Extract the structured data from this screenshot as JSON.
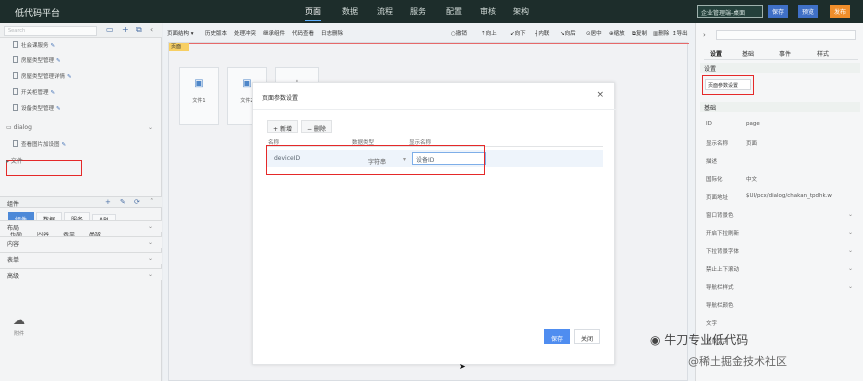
{
  "app": {
    "name": "低代码平台",
    "nav": [
      "页面",
      "数据",
      "流程",
      "服务",
      "配置",
      "审核",
      "架构"
    ],
    "env": "企业管理端-桌面",
    "buttons": [
      "保存",
      "预览",
      "发布"
    ]
  },
  "left": {
    "search_placeholder": "Search",
    "tree": [
      "社会课服务",
      "房屋类型管理",
      "房屋类型管理详情",
      "开关柜管理",
      "设备类型管理"
    ],
    "folder": "dialog",
    "selected": "查看图片加设图",
    "folder2": "文件",
    "comp_title": "组件",
    "comp_tabs": [
      "组件",
      "数据",
      "服务",
      "API"
    ],
    "subtabs": [
      "布局",
      "内容",
      "表单",
      "高级"
    ],
    "sections": [
      "布局",
      "内容",
      "表单",
      "高级"
    ],
    "upload_label": "附件"
  },
  "toolbar": {
    "items": [
      "页面结构 ▾",
      "历史版本",
      "处理冲突",
      "继承组件",
      "代码查看",
      "日志删除"
    ],
    "right": [
      "撤销",
      "向上",
      "向下",
      "内联",
      "向后",
      "居中",
      "缩放",
      "复制",
      "删除",
      "导出",
      "预览"
    ]
  },
  "canvas": {
    "page_tag": "页面",
    "tiles": [
      "文件1",
      "文件2"
    ]
  },
  "dialog": {
    "title": "页面参数设置",
    "close": "×",
    "add": "新增",
    "delete": "删除",
    "headers": [
      "名称",
      "数据类型",
      "显示名称"
    ],
    "row": {
      "name": "deviceID",
      "type": "字符串",
      "display": "设备ID"
    },
    "save": "保存",
    "close_btn": "关闭"
  },
  "right": {
    "tabs": [
      "设置",
      "基础",
      "事件",
      "样式"
    ],
    "section_settings": "设置",
    "page_params": "页面参数设置",
    "section_base": "基础",
    "props": [
      [
        "ID",
        "page"
      ],
      [
        "显示名称",
        "页面"
      ],
      [
        "描述",
        ""
      ],
      [
        "国际化",
        "中文"
      ],
      [
        "页面地址",
        "$UI/pcx/dialog/chakan_tpdhk.w"
      ],
      [
        "窗口背景色",
        ""
      ],
      [
        "开启下拉刷新",
        ""
      ],
      [
        "下拉背景字体",
        ""
      ],
      [
        "禁止上下滚动",
        ""
      ],
      [
        "导航栏样式",
        ""
      ],
      [
        "导航栏颜色",
        ""
      ],
      [
        "文字",
        ""
      ],
      [
        "背景文字",
        ""
      ]
    ]
  },
  "watermark": {
    "line1": "牛刀专业低代码",
    "line2": "@稀土掘金技术社区"
  }
}
